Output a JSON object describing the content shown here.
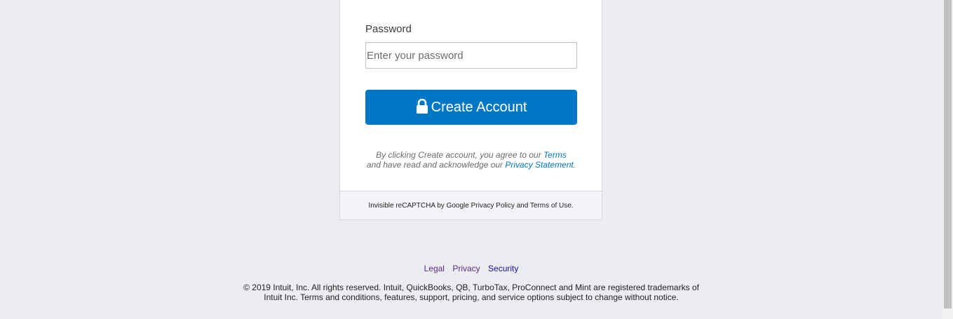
{
  "form": {
    "password_label": "Password",
    "password_placeholder": "Enter your password",
    "submit_label": "Create Account",
    "submit_icon": "lock-icon",
    "accent_color": "#0077c5"
  },
  "agreement": {
    "prefix": "By clicking Create account, you agree to our ",
    "terms_link": "Terms",
    "middle": " and have read and acknowledge our ",
    "privacy_link": "Privacy Statement",
    "suffix": "."
  },
  "recaptcha": {
    "text": "Invisible reCAPTCHA by Google Privacy Policy and Terms of Use."
  },
  "footer": {
    "links": [
      {
        "label": "Legal"
      },
      {
        "label": "Privacy"
      },
      {
        "label": "Security"
      }
    ],
    "copyright_line1": "© 2019 Intuit, Inc. All rights reserved. Intuit, QuickBooks, QB, TurboTax, ProConnect and Mint are registered trademarks of",
    "copyright_line2": "Intuit Inc. Terms and conditions, features, support, pricing, and service options subject to change without notice."
  }
}
